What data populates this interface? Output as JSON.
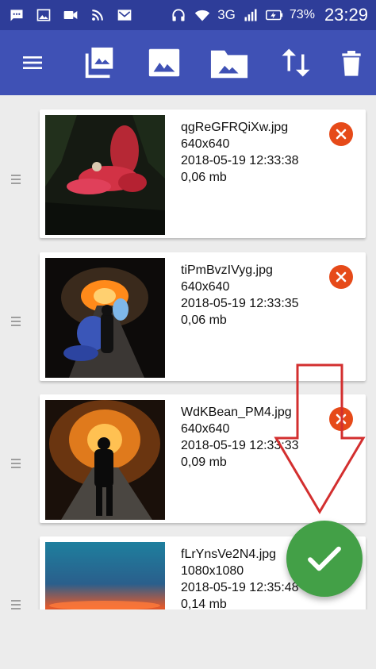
{
  "status_bar": {
    "network": "3G",
    "battery": "73%",
    "time": "23:29"
  },
  "toolbar": {
    "icons": [
      "menu-icon",
      "image-stack-icon",
      "image-icon",
      "folder-image-icon",
      "sort-icon",
      "delete-icon"
    ]
  },
  "images": [
    {
      "filename": "qgReGFRQiXw.jpg",
      "dimensions": "640x640",
      "date": "2018-05-19 12:33:38",
      "size": "0,06 mb"
    },
    {
      "filename": "tiPmBvzIVyg.jpg",
      "dimensions": "640x640",
      "date": "2018-05-19 12:33:35",
      "size": "0,06 mb"
    },
    {
      "filename": "WdKBean_PM4.jpg",
      "dimensions": "640x640",
      "date": "2018-05-19 12:33:33",
      "size": "0,09 mb"
    },
    {
      "filename": "fLrYnsVe2N4.jpg",
      "dimensions": "1080x1080",
      "date": "2018-05-19 12:35:48",
      "size": "0,14 mb"
    }
  ],
  "colors": {
    "status_bar": "#2e3d99",
    "toolbar": "#3f51b5",
    "remove": "#e64a19",
    "fab": "#43a047",
    "annotation_arrow": "#d32f2f"
  }
}
